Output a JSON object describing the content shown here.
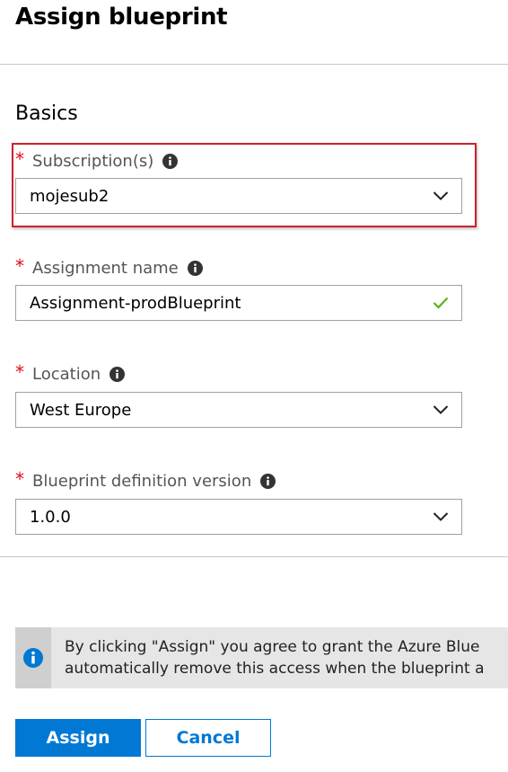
{
  "header": {
    "title": "Assign blueprint"
  },
  "section": {
    "title": "Basics"
  },
  "fields": {
    "subscription": {
      "required_mark": "*",
      "label": "Subscription(s)",
      "value": "mojesub2",
      "icon": "chevron-down-icon"
    },
    "assignment_name": {
      "required_mark": "*",
      "label": "Assignment name",
      "value": "Assignment-prodBlueprint",
      "icon": "check-icon"
    },
    "location": {
      "required_mark": "*",
      "label": "Location",
      "value": "West Europe",
      "icon": "chevron-down-icon"
    },
    "blueprint_version": {
      "required_mark": "*",
      "label": "Blueprint definition version",
      "value": "1.0.0",
      "icon": "chevron-down-icon"
    }
  },
  "notice": {
    "icon": "info-icon",
    "line1": "By clicking \"Assign\" you agree to grant the Azure Blue",
    "line2": "automatically remove this access when the blueprint a"
  },
  "buttons": {
    "assign": "Assign",
    "cancel": "Cancel"
  },
  "colors": {
    "accent": "#0078d4",
    "required": "#e00b1c",
    "highlight_border": "#d0202a",
    "valid_check": "#5bb318",
    "banner_bg": "#e6e6e6"
  }
}
